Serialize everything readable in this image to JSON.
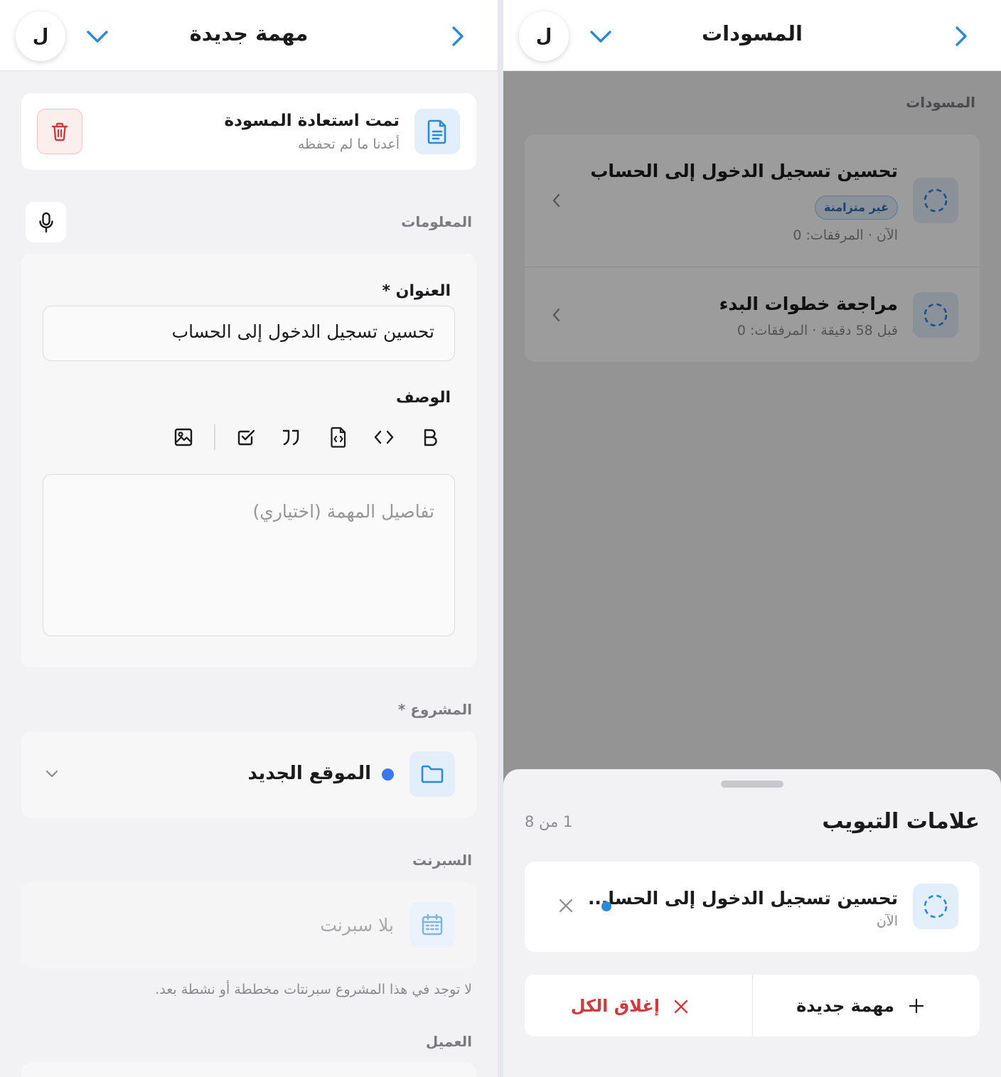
{
  "left": {
    "header": {
      "title": "مهمة جديدة",
      "avatar": "ل"
    },
    "restore": {
      "title": "تمت استعادة المسودة",
      "subtitle": "أعدنا ما لم تحفظه"
    },
    "info_label": "المعلومات",
    "title_field": {
      "label": "العنوان *",
      "value": "تحسين تسجيل الدخول إلى الحساب"
    },
    "description": {
      "label": "الوصف",
      "placeholder": "تفاصيل المهمة (اختياري)"
    },
    "project": {
      "label": "المشروع *",
      "value": "الموقع الجديد",
      "dot_color": "#3a78f2"
    },
    "sprint": {
      "label": "السبرنت",
      "value": "بلا سبرنت",
      "note": "لا توجد في هذا المشروع سبرنتات مخططة أو نشطة بعد."
    },
    "client": {
      "label": "العميل"
    }
  },
  "right": {
    "header": {
      "title": "المسودات",
      "avatar": "ل"
    },
    "section_label": "المسودات",
    "drafts": [
      {
        "title": "تحسين تسجيل الدخول إلى الحساب",
        "badge": "غير متزامنة",
        "meta": "الآن · المرفقات: 0"
      },
      {
        "title": "مراجعة خطوات البدء",
        "meta": "قبل 58 دقيقة · المرفقات: 0"
      }
    ],
    "sheet": {
      "title": "علامات التبويب",
      "counter": "1 من 8",
      "tab": {
        "title": "تحسين تسجيل الدخول إلى الحسا...",
        "time": "الآن"
      },
      "new_task": "مهمة جديدة",
      "close_all": "إغلاق الكل"
    }
  },
  "colors": {
    "accent": "#2a8ad8",
    "danger": "#d03a3a",
    "brand_blue": "#3a78f2"
  }
}
